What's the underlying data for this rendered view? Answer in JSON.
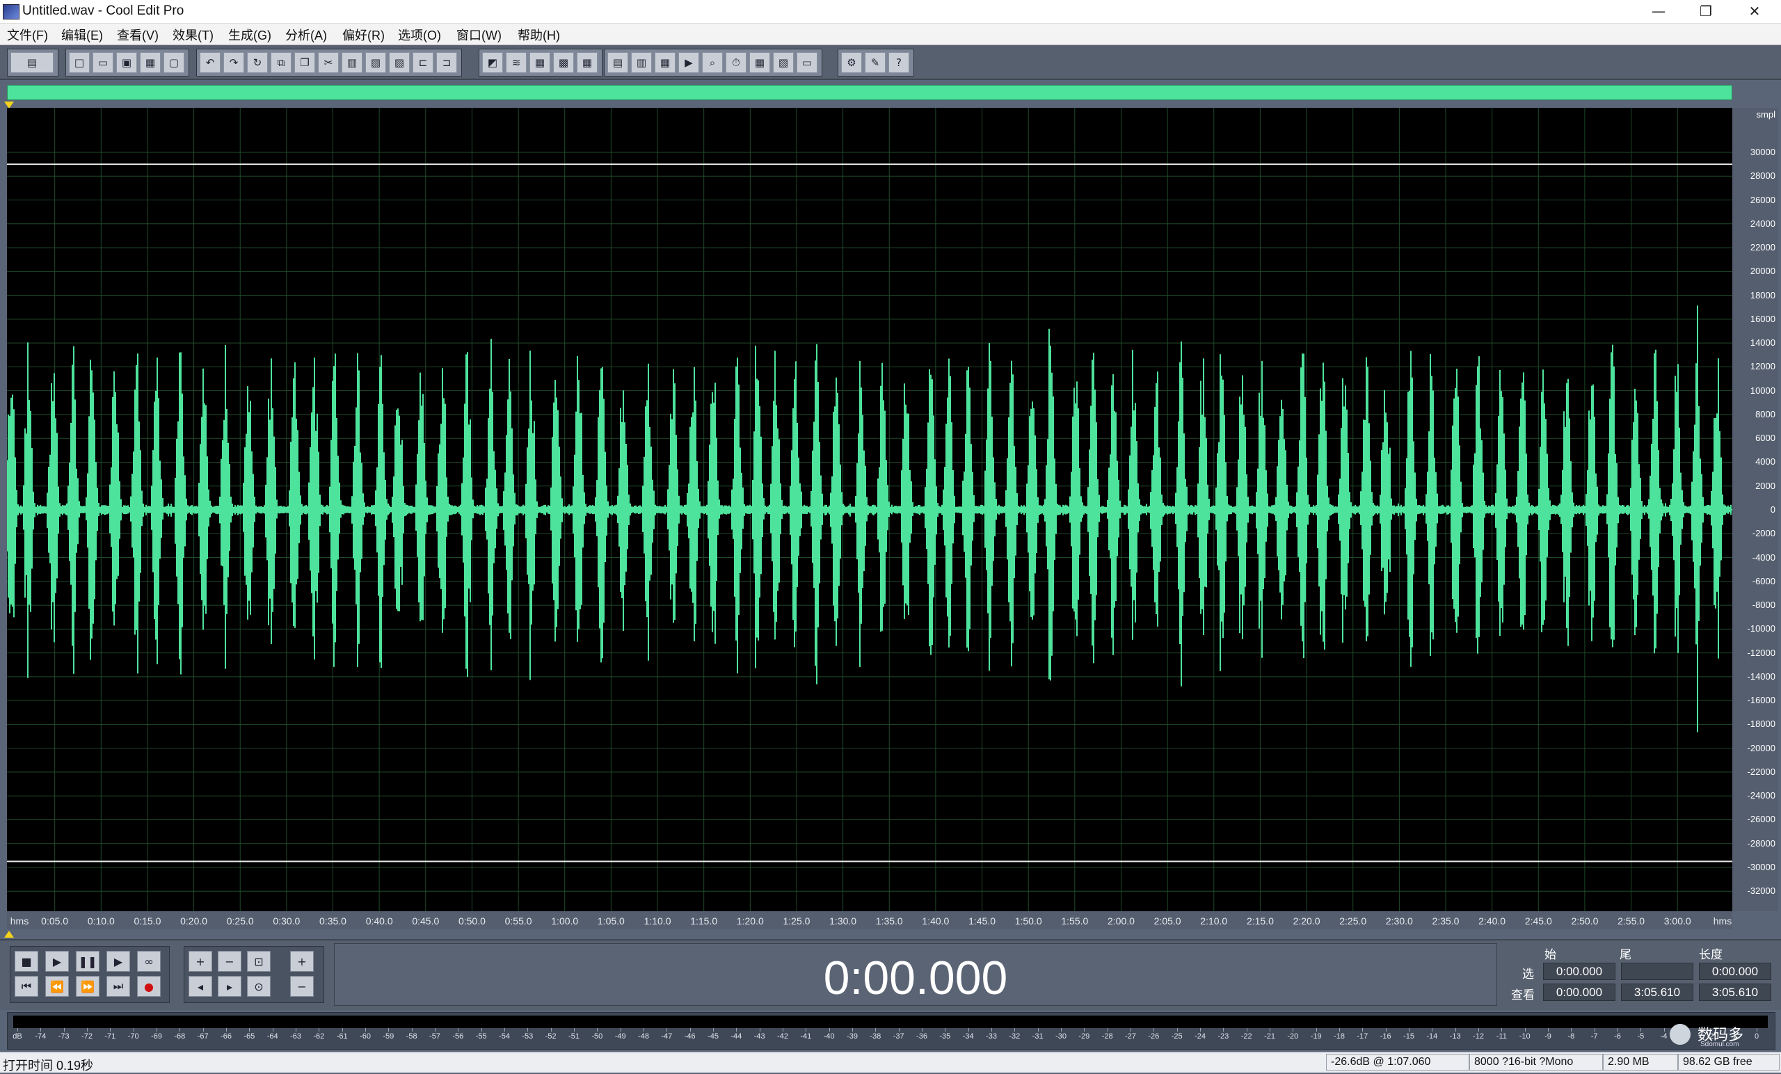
{
  "window": {
    "title": "Untitled.wav - Cool Edit Pro",
    "minimize_glyph": "—",
    "restore_glyph": "❐",
    "close_glyph": "✕"
  },
  "menu": [
    {
      "label": "文件(F)"
    },
    {
      "label": "编辑(E)"
    },
    {
      "label": "查看(V)"
    },
    {
      "label": "效果(T)"
    },
    {
      "label": "生成(G)"
    },
    {
      "label": "分析(A)"
    },
    {
      "label": "偏好(R)"
    },
    {
      "label": "选项(O)"
    },
    {
      "label": "窗口(W)"
    },
    {
      "label": "帮助(H)"
    }
  ],
  "toolbar": {
    "groups": [
      {
        "icons": [
          "multitrack-toggle-icon"
        ]
      },
      {
        "icons": [
          "new-file-icon",
          "open-file-icon",
          "save-icon",
          "save-as-icon",
          "close-file-icon"
        ]
      },
      {
        "icons": [
          "undo-icon",
          "redo-icon",
          "repeat-icon",
          "copy-new-icon",
          "copy-icon",
          "cut-icon",
          "paste-icon",
          "paste-new-icon",
          "mix-paste-icon",
          "trim-icon",
          "crop-icon"
        ]
      },
      {
        "icons": [
          "envelope-icon",
          "noise-reduction-icon",
          "mark-icon",
          "region-icon",
          "cue-icon"
        ]
      },
      {
        "icons": [
          "spectral-view-icon",
          "waveform-view-icon",
          "cue-list-icon",
          "play-list-icon",
          "zoom-view-icon",
          "time-window-icon",
          "info-window-icon",
          "analysis-icon",
          "organizer-icon"
        ]
      },
      {
        "icons": [
          "settings-icon",
          "scripts-icon",
          "help-icon"
        ]
      }
    ]
  },
  "waveform": {
    "wave_color": "#4ee39c",
    "grid_color": "#1f4a2a",
    "background": "#000000",
    "amplitude_unit": "smpl",
    "amplitude_labels": [
      "30000",
      "28000",
      "26000",
      "24000",
      "22000",
      "20000",
      "18000",
      "16000",
      "14000",
      "12000",
      "10000",
      "8000",
      "6000",
      "4000",
      "2000",
      "0",
      "-2000",
      "-4000",
      "-6000",
      "-8000",
      "-10000",
      "-12000",
      "-14000",
      "-16000",
      "-18000",
      "-20000",
      "-22000",
      "-24000",
      "-26000",
      "-28000",
      "-30000",
      "-32000"
    ],
    "time_unit": "hms",
    "time_labels": [
      "0:05.0",
      "0:10.0",
      "0:15.0",
      "0:20.0",
      "0:25.0",
      "0:30.0",
      "0:35.0",
      "0:40.0",
      "0:45.0",
      "0:50.0",
      "0:55.0",
      "1:00.0",
      "1:05.0",
      "1:10.0",
      "1:15.0",
      "1:20.0",
      "1:25.0",
      "1:30.0",
      "1:35.0",
      "1:40.0",
      "1:45.0",
      "1:50.0",
      "1:55.0",
      "2:00.0",
      "2:05.0",
      "2:10.0",
      "2:15.0",
      "2:20.0",
      "2:25.0",
      "2:30.0",
      "2:35.0",
      "2:40.0",
      "2:45.0",
      "2:50.0",
      "2:55.0",
      "3:00.0"
    ],
    "length_seconds": 185.61,
    "peak_max_samples": 29000
  },
  "transport": {
    "buttons_row1": [
      {
        "name": "stop-button",
        "glyph": "■"
      },
      {
        "name": "play-button",
        "glyph": "▶"
      },
      {
        "name": "pause-button",
        "glyph": "❚❚"
      },
      {
        "name": "play-to-end-button",
        "glyph": "▶"
      },
      {
        "name": "loop-button",
        "glyph": "∞"
      }
    ],
    "buttons_row2": [
      {
        "name": "go-to-start-button",
        "glyph": "⏮"
      },
      {
        "name": "rewind-button",
        "glyph": "⏪"
      },
      {
        "name": "fast-forward-button",
        "glyph": "⏩"
      },
      {
        "name": "go-to-end-button",
        "glyph": "⏭"
      },
      {
        "name": "record-button",
        "glyph": "●"
      }
    ],
    "zoom_row1": [
      {
        "name": "zoom-in-h-button",
        "glyph": "+"
      },
      {
        "name": "zoom-out-h-button",
        "glyph": "−"
      },
      {
        "name": "zoom-full-button",
        "glyph": "⊡"
      },
      {
        "name": "zoom-in-v-button",
        "glyph": "+"
      }
    ],
    "zoom_row2": [
      {
        "name": "zoom-left-button",
        "glyph": "◂"
      },
      {
        "name": "zoom-right-button",
        "glyph": "▸"
      },
      {
        "name": "zoom-selection-button",
        "glyph": "⊙"
      },
      {
        "name": "zoom-out-v-button",
        "glyph": "−"
      }
    ],
    "time_display": "0:00.000"
  },
  "selection": {
    "col_start": "始",
    "col_end": "尾",
    "col_length": "长度",
    "row_select": "选",
    "row_view": "查看",
    "select_start": "0:00.000",
    "select_end": "",
    "select_length": "0:00.000",
    "view_start": "0:00.000",
    "view_end": "3:05.610",
    "view_length": "3:05.610"
  },
  "level_meter": {
    "labels": [
      "dB",
      "-74",
      "-73",
      "-72",
      "-71",
      "-70",
      "-69",
      "-68",
      "-67",
      "-66",
      "-65",
      "-64",
      "-63",
      "-62",
      "-61",
      "-60",
      "-59",
      "-58",
      "-57",
      "-56",
      "-55",
      "-54",
      "-53",
      "-52",
      "-51",
      "-50",
      "-49",
      "-48",
      "-47",
      "-46",
      "-45",
      "-44",
      "-43",
      "-42",
      "-41",
      "-40",
      "-39",
      "-38",
      "-37",
      "-36",
      "-35",
      "-34",
      "-33",
      "-32",
      "-31",
      "-30",
      "-29",
      "-28",
      "-27",
      "-26",
      "-25",
      "-24",
      "-23",
      "-22",
      "-21",
      "-20",
      "-19",
      "-18",
      "-17",
      "-16",
      "-15",
      "-14",
      "-13",
      "-12",
      "-11",
      "-10",
      "-9",
      "-8",
      "-7",
      "-6",
      "-5",
      "-4",
      "-3",
      "-2",
      "-1",
      "0"
    ]
  },
  "status": {
    "left_text": "打开时间  0.19秒",
    "cursor_level": "-26.6dB @  1:07.060",
    "format": "8000 ?16-bit ?Mono",
    "file_size": "2.90 MB",
    "disk_free": "98.62 GB free"
  },
  "watermark": {
    "text": "数码多",
    "subtext": "Sdomul.com"
  }
}
